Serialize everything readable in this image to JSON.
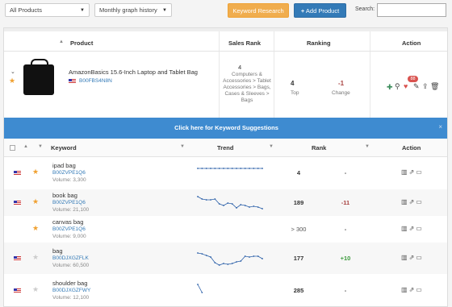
{
  "toolbar": {
    "filter_select": "All Products",
    "graph_select": "Monthly graph history",
    "keyword_research": "Keyword Research",
    "add_product": "Add Product",
    "add_icon": "+",
    "search_label": "Search:"
  },
  "product_table": {
    "headers": {
      "product": "Product",
      "sales_rank": "Sales Rank",
      "ranking": "Ranking",
      "action": "Action"
    },
    "product": {
      "title": "AmazonBasics 15.6-Inch Laptop and Tablet Bag",
      "asin": "B00FBS4N8N",
      "sales_rank_value": "4",
      "sales_rank_category": "Computers & Accessories > Tablet Accessories > Bags, Cases & Sleeves > Bags",
      "top_value": "4",
      "top_label": "Top",
      "change_value": "-1",
      "change_label": "Change",
      "badge_count": "88"
    }
  },
  "banner": {
    "text": "Click here for Keyword Suggestions",
    "close": "×"
  },
  "keyword_table": {
    "headers": {
      "keyword": "Keyword",
      "trend": "Trend",
      "rank": "Rank",
      "action": "Action"
    },
    "rows": [
      {
        "keyword": "ipad bag",
        "asin": "B00ZVPE1Q6",
        "volume": "Volume: 3,300",
        "rank": "4",
        "change": "-",
        "star": "orange",
        "flag": true,
        "trend": [
          4,
          4,
          4,
          4,
          4,
          4,
          4,
          4,
          4,
          4,
          4,
          4,
          4,
          4,
          4,
          4
        ]
      },
      {
        "keyword": "book bag",
        "asin": "B00ZVPE1Q6",
        "volume": "Volume: 21,100",
        "rank": "189",
        "change": "-11",
        "star": "orange",
        "flag": true,
        "trend": [
          2,
          5,
          6,
          6,
          5,
          11,
          13,
          10,
          11,
          16,
          12,
          13,
          15,
          14,
          15,
          17
        ]
      },
      {
        "keyword": "canvas bag",
        "asin": "B00ZVPE1Q6",
        "volume": "Volume: 9,000",
        "rank": "> 300",
        "change": "-",
        "star": "orange",
        "flag": false,
        "trend": []
      },
      {
        "keyword": "bag",
        "asin": "B00DJXGZFLK",
        "volume": "Volume: 60,500",
        "rank": "177",
        "change": "+10",
        "star": "grey",
        "flag": true,
        "trend": [
          3,
          4,
          6,
          8,
          15,
          18,
          16,
          17,
          16,
          14,
          13,
          7,
          8,
          7,
          7,
          10
        ]
      },
      {
        "keyword": "shoulder bag",
        "asin": "B00DJXGZFWY",
        "volume": "Volume: 12,100",
        "rank": "285",
        "change": "-",
        "star": "grey",
        "flag": true,
        "trend": [
          2,
          12,
          null,
          null,
          null,
          null,
          null,
          null,
          null,
          null,
          null,
          null,
          null,
          null,
          null,
          null
        ]
      }
    ]
  },
  "icons": {
    "expand": "chevron-down-icon",
    "favorite": "star-icon",
    "add": "plus-icon",
    "search": "search-icon",
    "heart": "heart-icon",
    "edit": "edit-icon",
    "delete": "trash-icon",
    "chart": "bar-chart-icon",
    "external": "external-link-icon"
  },
  "colors": {
    "accent_blue": "#3e8bd0",
    "orange": "#f0ad4e",
    "negative": "#a94442",
    "positive": "#3c9a3c",
    "star_orange": "#f0a030",
    "trend_line": "#2a5fa8"
  }
}
